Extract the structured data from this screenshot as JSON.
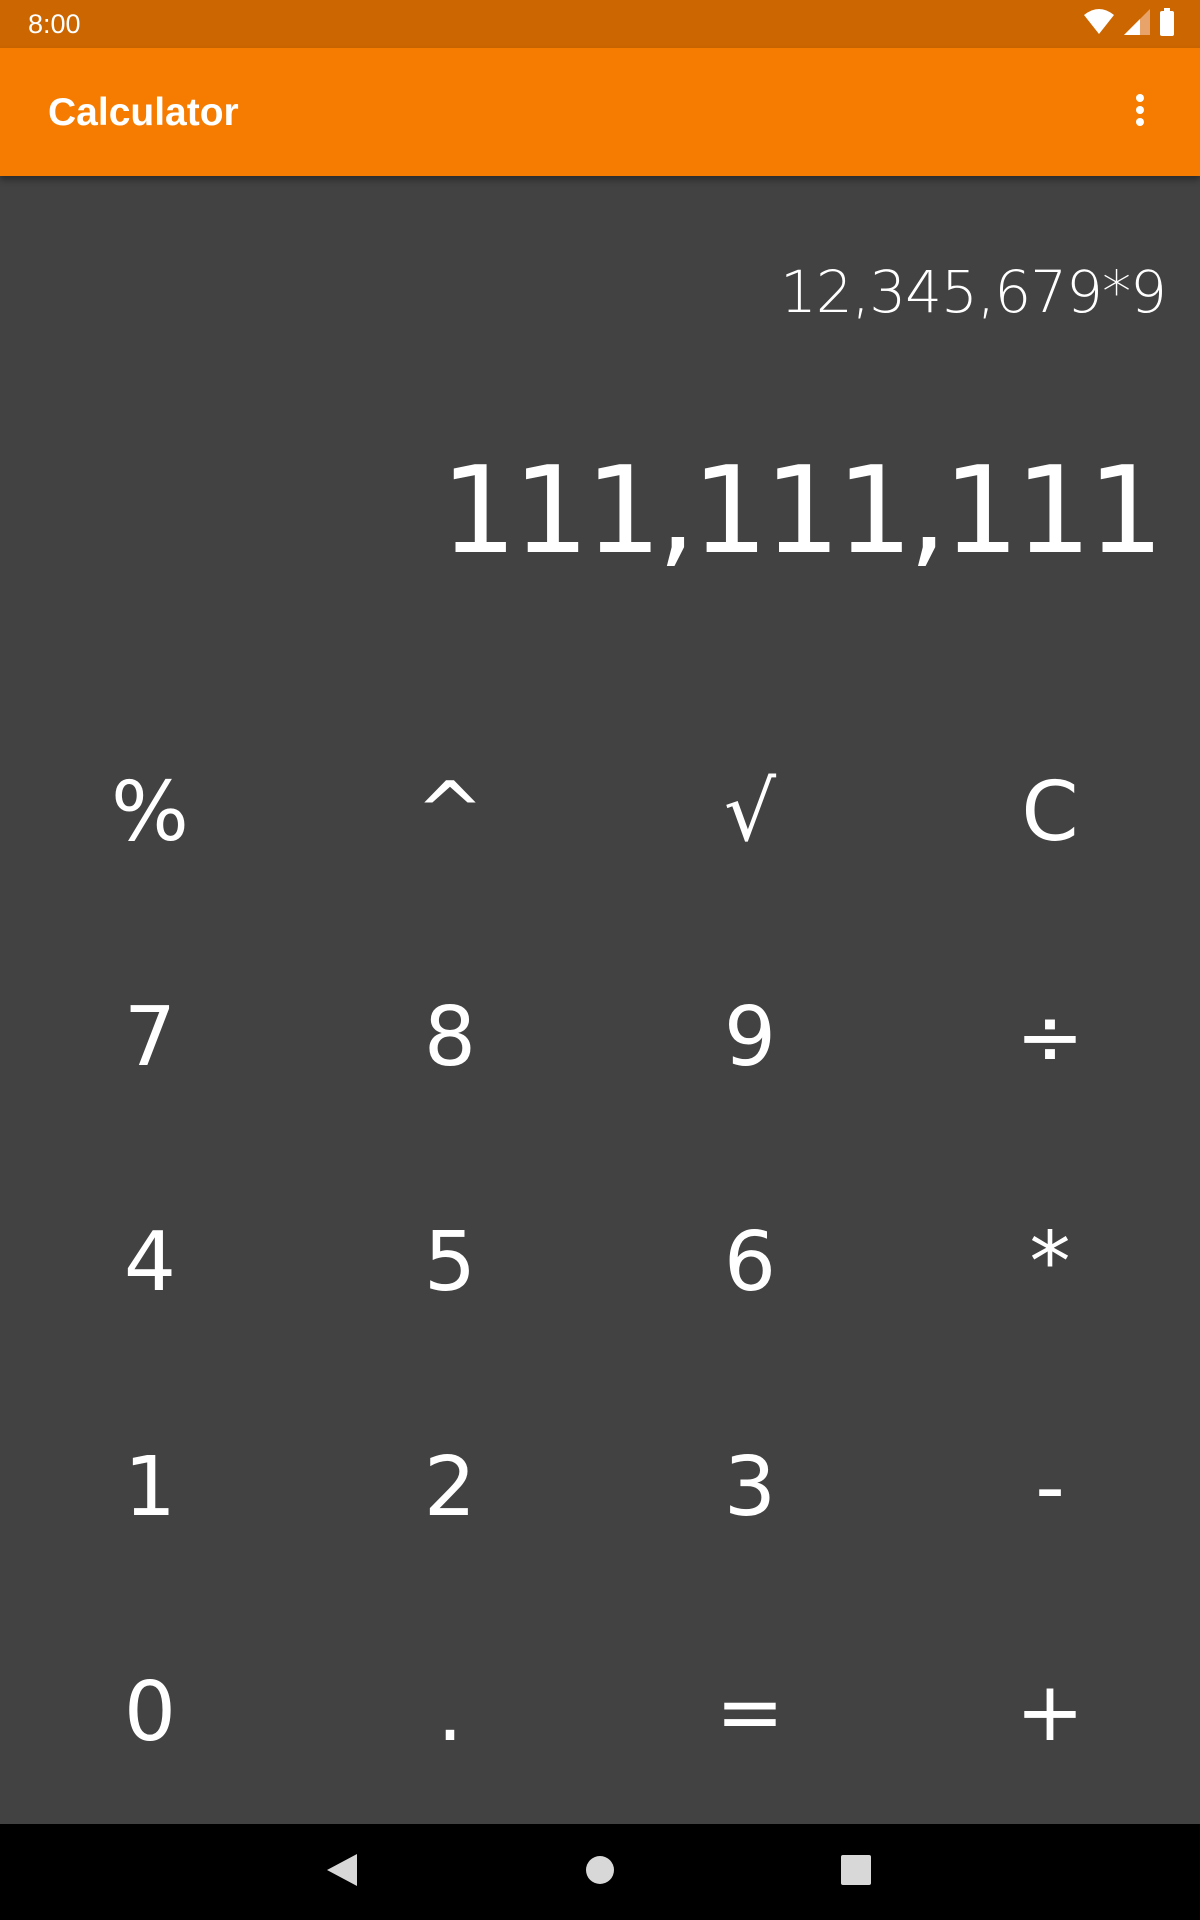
{
  "status_bar": {
    "time": "8:00",
    "icons": [
      "wifi-icon",
      "cell-signal-icon",
      "battery-icon"
    ],
    "color": "#CC6600"
  },
  "app_bar": {
    "title": "Calculator",
    "menu_icon": "more-vert-icon",
    "color": "#F57C00"
  },
  "display": {
    "formula": "12,345,679*9",
    "result": "111,111,111",
    "background": "#424242"
  },
  "keypad": {
    "keys": [
      {
        "label": "%",
        "name": "key-percent"
      },
      {
        "label": "^",
        "name": "key-power"
      },
      {
        "label": "√",
        "name": "key-sqrt"
      },
      {
        "label": "C",
        "name": "key-clear"
      },
      {
        "label": "7",
        "name": "key-7"
      },
      {
        "label": "8",
        "name": "key-8"
      },
      {
        "label": "9",
        "name": "key-9"
      },
      {
        "label": "÷",
        "name": "key-divide"
      },
      {
        "label": "4",
        "name": "key-4"
      },
      {
        "label": "5",
        "name": "key-5"
      },
      {
        "label": "6",
        "name": "key-6"
      },
      {
        "label": "*",
        "name": "key-multiply"
      },
      {
        "label": "1",
        "name": "key-1"
      },
      {
        "label": "2",
        "name": "key-2"
      },
      {
        "label": "3",
        "name": "key-3"
      },
      {
        "label": "-",
        "name": "key-subtract"
      },
      {
        "label": "0",
        "name": "key-0"
      },
      {
        "label": ".",
        "name": "key-decimal"
      },
      {
        "label": "=",
        "name": "key-equals"
      },
      {
        "label": "+",
        "name": "key-add"
      }
    ]
  },
  "nav_bar": {
    "icons": [
      "back-icon",
      "home-icon",
      "recents-icon"
    ]
  }
}
